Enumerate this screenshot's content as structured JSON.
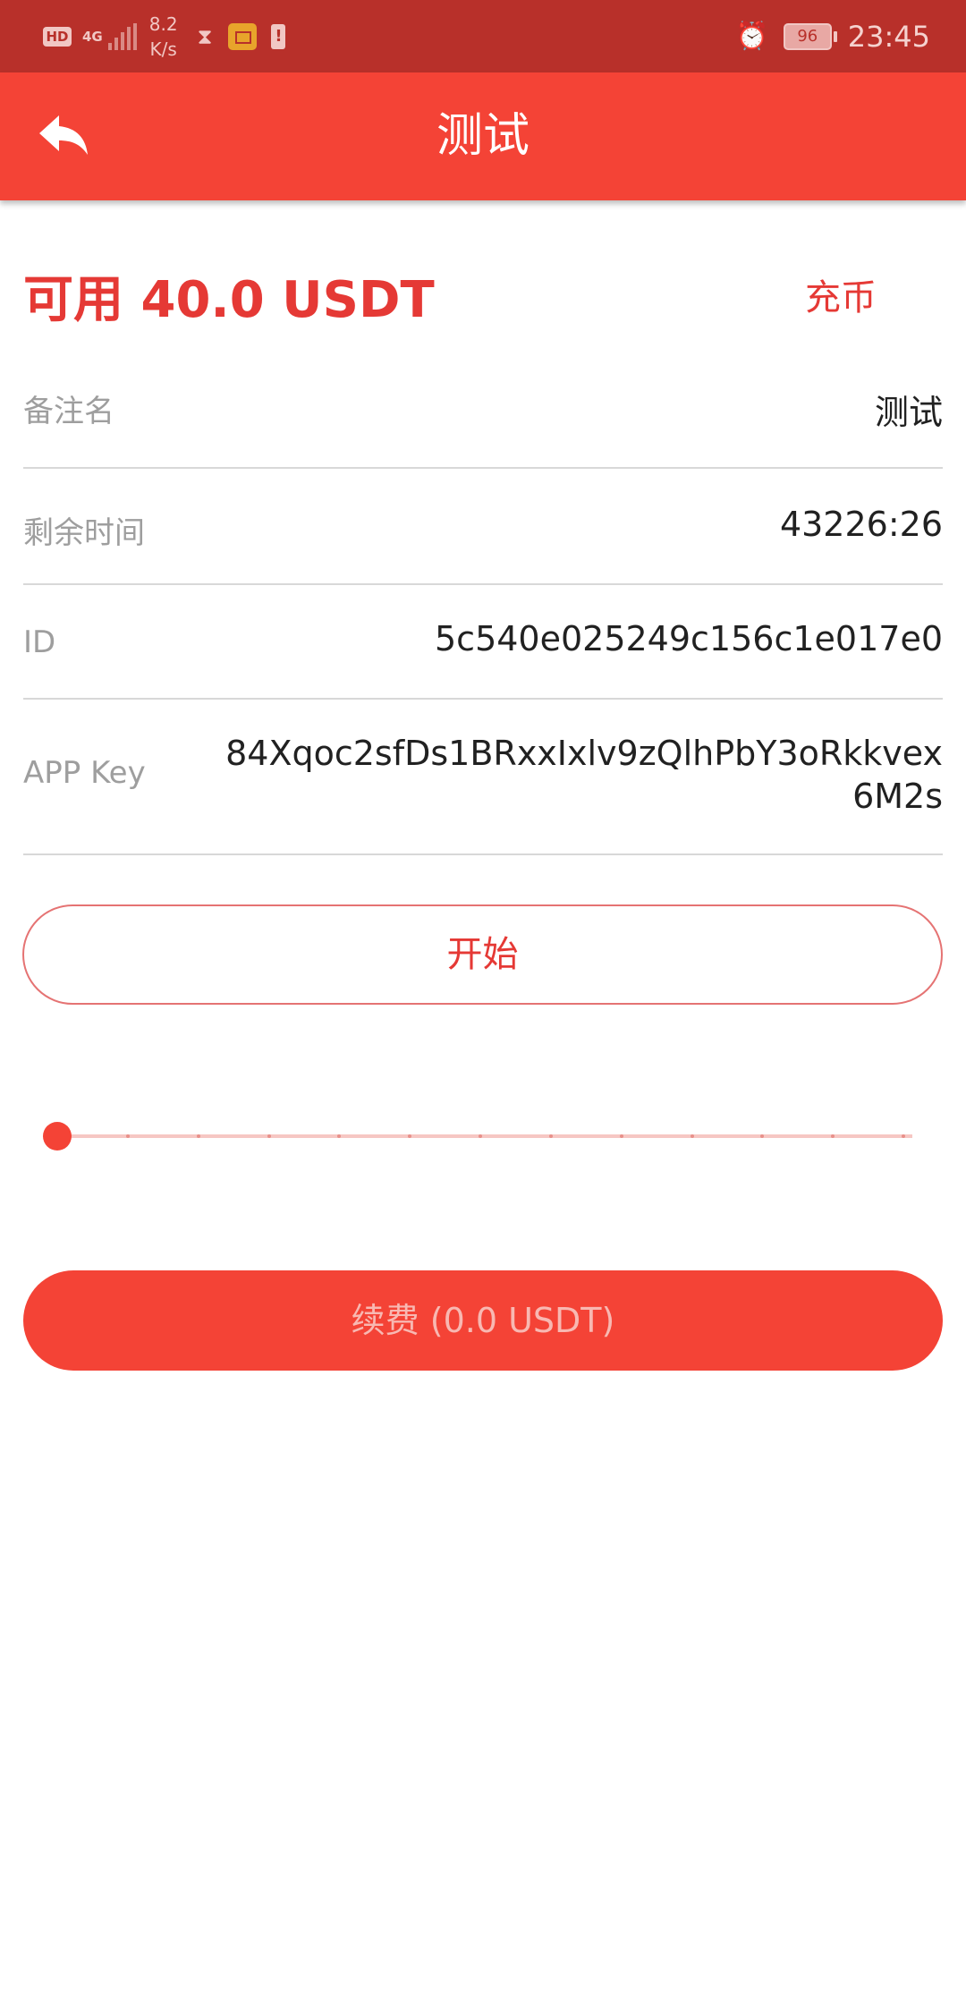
{
  "status_bar": {
    "hd_label": "HD",
    "network_label": "4G",
    "speed_value": "8.2",
    "speed_unit": "K/s",
    "battery_level": "96",
    "time": "23:45",
    "icons": [
      "hd-icon",
      "signal-icon",
      "hourglass-icon",
      "mail-icon",
      "battery-warning-icon",
      "alarm-icon",
      "battery-icon"
    ]
  },
  "app_bar": {
    "title": "测试",
    "back_icon": "back-arrow-icon"
  },
  "balance": {
    "text": "可用 40.0 USDT",
    "recharge_label": "充币"
  },
  "info": {
    "remark_label": "备注名",
    "remark_value": "测试",
    "time_label": "剩余时间",
    "time_value": "43226:26",
    "id_label": "ID",
    "id_value": "5c540e025249c156c1e017e0",
    "appkey_label": "APP Key",
    "appkey_value": "84Xqoc2sfDs1BRxxIxlv9zQlhPbY3oRkkvex6M2s"
  },
  "start_button_label": "开始",
  "slider": {
    "steps": 12,
    "value": 0
  },
  "renew_button_label": "续费 (0.0 USDT)",
  "colors": {
    "status_bar": "#b8302a",
    "accent": "#f44336",
    "accent_text": "#e53935"
  }
}
